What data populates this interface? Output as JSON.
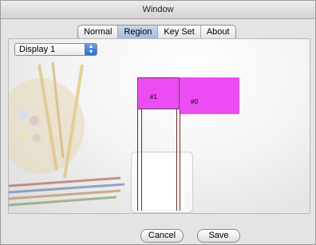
{
  "window": {
    "title": "Window"
  },
  "tabs": [
    {
      "label": "Normal",
      "selected": false
    },
    {
      "label": "Region",
      "selected": true
    },
    {
      "label": "Key Set",
      "selected": false
    },
    {
      "label": "About",
      "selected": false
    }
  ],
  "display_select": {
    "value": "Display 1"
  },
  "regions": [
    {
      "label": "#1",
      "color": "#ec4df2"
    },
    {
      "label": "#0",
      "color": "#ec4df2"
    }
  ],
  "buttons": {
    "cancel": "Cancel",
    "save": "Save"
  },
  "colors": {
    "selected_tab": "#a9c2e6",
    "region_fill": "#ec4df2",
    "select_arrow": "#3c78d8"
  }
}
